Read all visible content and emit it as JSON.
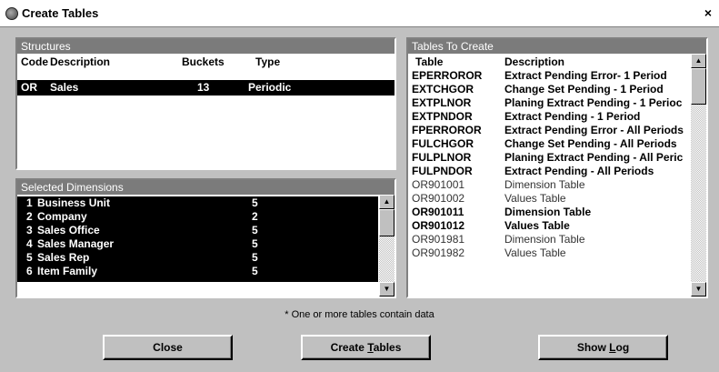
{
  "window": {
    "title": "Create Tables",
    "close_glyph": "×"
  },
  "structures": {
    "header": "Structures",
    "columns": [
      "Code",
      "Description",
      "Buckets",
      "Type"
    ],
    "rows": [
      {
        "code": "OR",
        "description": "Sales",
        "buckets": "13",
        "type": "Periodic"
      }
    ]
  },
  "selected_dimensions": {
    "header": "Selected Dimensions",
    "rows": [
      {
        "index": "1",
        "name": "Business Unit",
        "value": "5"
      },
      {
        "index": "2",
        "name": "Company",
        "value": "2"
      },
      {
        "index": "3",
        "name": "Sales Office",
        "value": "5"
      },
      {
        "index": "4",
        "name": "Sales Manager",
        "value": "5"
      },
      {
        "index": "5",
        "name": "Sales Rep",
        "value": "5"
      },
      {
        "index": "6",
        "name": "Item Family",
        "value": "5"
      }
    ]
  },
  "tables_to_create": {
    "header": "Tables To Create",
    "columns": [
      "Table",
      "Description"
    ],
    "rows": [
      {
        "table": "EPERROROR",
        "description": "Extract Pending Error- 1 Period",
        "emphasis": true
      },
      {
        "table": "EXTCHGOR",
        "description": "Change Set Pending - 1 Period",
        "emphasis": true
      },
      {
        "table": "EXTPLNOR",
        "description": "Planing Extract Pending - 1 Perioc",
        "emphasis": true
      },
      {
        "table": "EXTPNDOR",
        "description": "Extract Pending - 1 Period",
        "emphasis": true
      },
      {
        "table": "FPERROROR",
        "description": "Extract Pending Error - All Periods",
        "emphasis": true
      },
      {
        "table": "FULCHGOR",
        "description": "Change Set Pending - All Periods",
        "emphasis": true
      },
      {
        "table": "FULPLNOR",
        "description": "Planing Extract Pending - All Peric",
        "emphasis": true
      },
      {
        "table": "FULPNDOR",
        "description": "Extract Pending - All Periods",
        "emphasis": true
      },
      {
        "table": "OR901001",
        "description": "Dimension Table",
        "emphasis": false
      },
      {
        "table": "OR901002",
        "description": "Values Table",
        "emphasis": false
      },
      {
        "table": "OR901011",
        "description": "Dimension Table",
        "emphasis": true
      },
      {
        "table": "OR901012",
        "description": "Values Table",
        "emphasis": true
      },
      {
        "table": "OR901981",
        "description": "Dimension Table",
        "emphasis": false
      },
      {
        "table": "OR901982",
        "description": "Values Table",
        "emphasis": false
      }
    ]
  },
  "note": "* One or more tables contain data",
  "buttons": {
    "close": "Close",
    "create_tables_pre": "Create ",
    "create_tables_key": "T",
    "create_tables_post": "ables",
    "show_log_pre": "Show ",
    "show_log_key": "L",
    "show_log_post": "og"
  }
}
